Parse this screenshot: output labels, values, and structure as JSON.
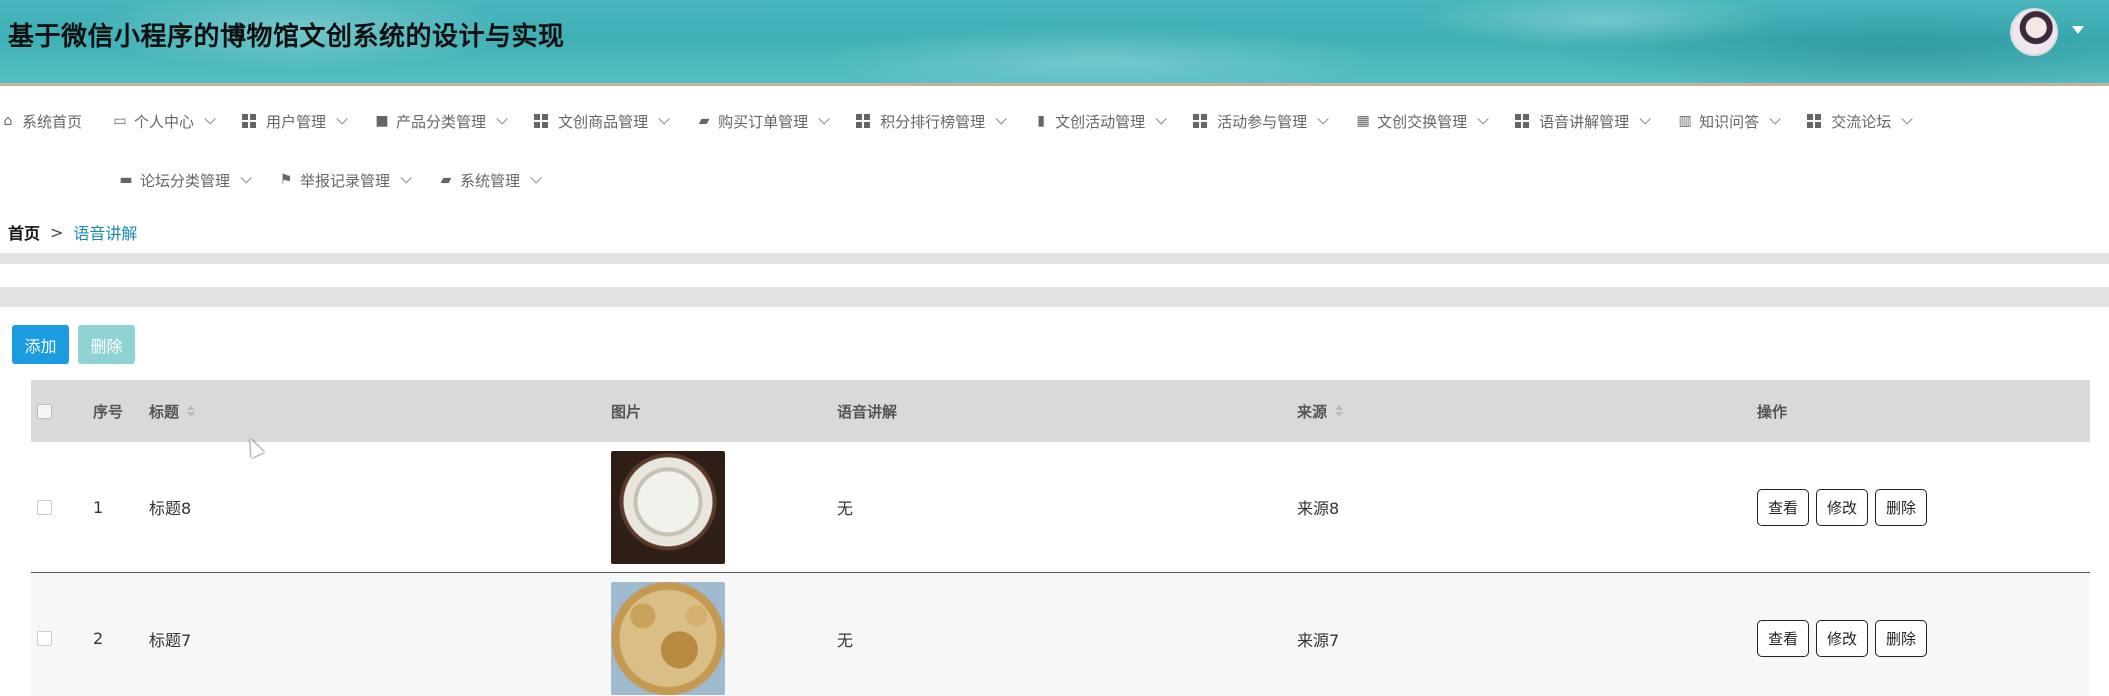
{
  "header": {
    "title": "基于微信小程序的博物馆文创系统的设计与实现"
  },
  "nav": {
    "row1": [
      {
        "label": "系统首页",
        "icon": "home-icon"
      },
      {
        "label": "个人中心",
        "icon": "profile-icon"
      },
      {
        "label": "用户管理",
        "icon": "grid-icon"
      },
      {
        "label": "产品分类管理",
        "icon": "comment-icon"
      },
      {
        "label": "文创商品管理",
        "icon": "grid-icon"
      },
      {
        "label": "购买订单管理",
        "icon": "briefcase-icon"
      },
      {
        "label": "积分排行榜管理",
        "icon": "grid-icon"
      },
      {
        "label": "文创活动管理",
        "icon": "clipboard-icon"
      },
      {
        "label": "活动参与管理",
        "icon": "grid-icon"
      },
      {
        "label": "文创交换管理",
        "icon": "apps-icon"
      },
      {
        "label": "语音讲解管理",
        "icon": "grid-icon"
      },
      {
        "label": "知识问答",
        "icon": "books-icon"
      },
      {
        "label": "交流论坛",
        "icon": "grid-icon"
      }
    ],
    "row2": [
      {
        "label": "论坛分类管理",
        "icon": "monitor-icon"
      },
      {
        "label": "举报记录管理",
        "icon": "flag-icon"
      },
      {
        "label": "系统管理",
        "icon": "briefcase-icon"
      }
    ]
  },
  "breadcrumb": {
    "home": "首页",
    "separator": ">",
    "current": "语音讲解"
  },
  "toolbar": {
    "add_label": "添加",
    "delete_label": "删除"
  },
  "table": {
    "columns": {
      "index": "序号",
      "title": "标题",
      "image": "图片",
      "audio": "语音讲解",
      "source": "来源",
      "actions": "操作"
    },
    "rows": [
      {
        "index": "1",
        "title": "标题8",
        "audio": "无",
        "source": "来源8",
        "image": "porcelain-plate"
      },
      {
        "index": "2",
        "title": "标题7",
        "audio": "无",
        "source": "来源7",
        "image": "bamboo-crafts"
      }
    ],
    "actions": {
      "view": "查看",
      "edit": "修改",
      "delete": "删除"
    }
  },
  "colors": {
    "header_teal": "#49b7bd",
    "primary_blue": "#1b9be0",
    "disabled_teal": "#8fd3d3",
    "breadcrumb_active": "#1b8ab5"
  }
}
